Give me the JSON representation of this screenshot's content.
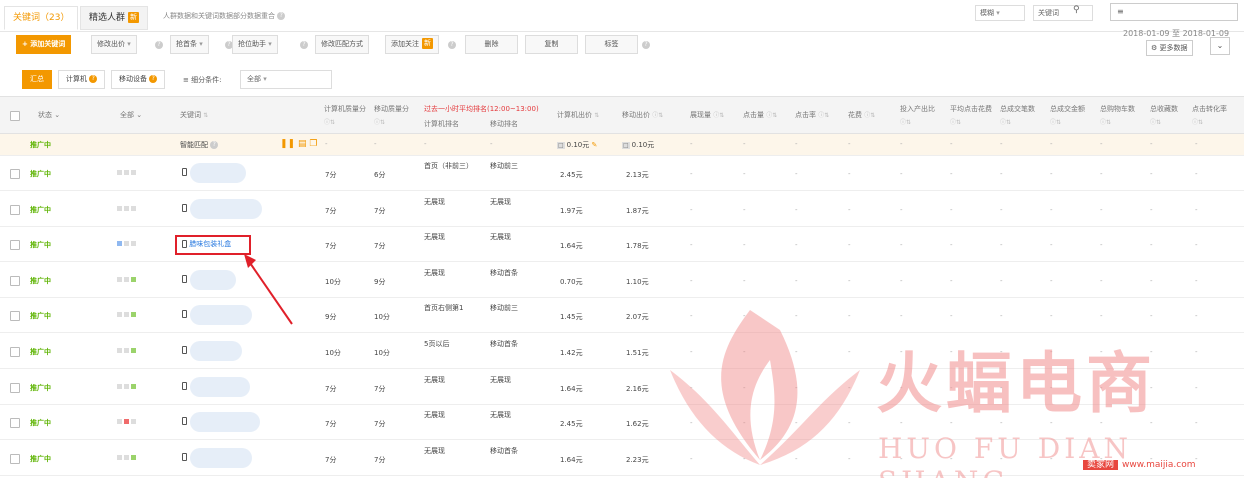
{
  "tabs": {
    "keywords": "关键词（23）",
    "crowd": "精选人群",
    "crowd_badge": "新",
    "tip": "人群数据和关键词数据部分数据重合"
  },
  "top_right": {
    "select1": "模糊",
    "select2": "关键词",
    "search_icon": "search-icon",
    "box_icon": "≡"
  },
  "toolbar": {
    "add_keyword": "+ 添加关键词",
    "modify_bid": "修改出价",
    "grab_rank": "抢首条",
    "rank_bid": "抢位助手",
    "modify_match": "修改匹配方式",
    "add_focus": "添加关注",
    "add_focus_badge": "新",
    "delete": "删除",
    "copy": "复制",
    "label": "标签",
    "date_range": "2018-01-09 至 2018-01-09",
    "more_data": "更多数据"
  },
  "filter": {
    "summary": "汇总",
    "computer": "计算机",
    "mobile": "移动设备",
    "condition_label": "细分条件:",
    "condition_value": "全部"
  },
  "headers": {
    "status": "状态",
    "all": "全部",
    "keyword": "关键词",
    "pc_quality": "计算机质量分",
    "mobile_quality": "移动质量分",
    "avg_rank": "过去一小时平均排名(12:00~13:00)",
    "pc_rank": "计算机排名",
    "mobile_rank": "移动排名",
    "pc_bid": "计算机出价",
    "mobile_bid": "移动出价",
    "impressions": "展现量",
    "clicks": "点击量",
    "ctr": "点击率",
    "cost": "花费",
    "roi": "投入产出比",
    "avg_cpc": "平均点击花费",
    "deal_count": "总成交笔数",
    "deal_amount": "总成交金额",
    "cart": "总购物车数",
    "fav": "总收藏数",
    "cvr": "点击转化率"
  },
  "smart_match": {
    "status": "推广中",
    "keyword": "智能匹配",
    "pc_bid": "0.10元",
    "mobile_bid": "0.10元",
    "dash": "-"
  },
  "rows": [
    {
      "status": "推广中",
      "keyword": "",
      "pc_q": "7分",
      "m_q": "6分",
      "pc_rank": "首页（非前三）",
      "m_rank": "移动前三",
      "pc_bid": "2.45元",
      "m_bid": "2.13元"
    },
    {
      "status": "推广中",
      "keyword": "",
      "pc_q": "7分",
      "m_q": "7分",
      "pc_rank": "无展现",
      "m_rank": "无展现",
      "pc_bid": "1.97元",
      "m_bid": "1.87元"
    },
    {
      "status": "推广中",
      "keyword": "腊味包装礼盒",
      "pc_q": "7分",
      "m_q": "7分",
      "pc_rank": "无展现",
      "m_rank": "无展现",
      "pc_bid": "1.64元",
      "m_bid": "1.78元"
    },
    {
      "status": "推广中",
      "keyword": "",
      "pc_q": "10分",
      "m_q": "9分",
      "pc_rank": "无展现",
      "m_rank": "移动首条",
      "pc_bid": "0.70元",
      "m_bid": "1.10元"
    },
    {
      "status": "推广中",
      "keyword": "",
      "pc_q": "9分",
      "m_q": "10分",
      "pc_rank": "首页右侧第1",
      "m_rank": "移动前三",
      "pc_bid": "1.45元",
      "m_bid": "2.07元"
    },
    {
      "status": "推广中",
      "keyword": "",
      "pc_q": "10分",
      "m_q": "10分",
      "pc_rank": "5页以后",
      "m_rank": "移动首条",
      "pc_bid": "1.42元",
      "m_bid": "1.51元"
    },
    {
      "status": "推广中",
      "keyword": "",
      "pc_q": "7分",
      "m_q": "7分",
      "pc_rank": "无展现",
      "m_rank": "无展现",
      "pc_bid": "1.64元",
      "m_bid": "2.16元"
    },
    {
      "status": "推广中",
      "keyword": "",
      "pc_q": "7分",
      "m_q": "7分",
      "pc_rank": "无展现",
      "m_rank": "无展现",
      "pc_bid": "2.45元",
      "m_bid": "1.62元"
    },
    {
      "status": "推广中",
      "keyword": "",
      "pc_q": "7分",
      "m_q": "7分",
      "pc_rank": "无展现",
      "m_rank": "移动首条",
      "pc_bid": "1.64元",
      "m_bid": "2.23元"
    }
  ],
  "watermark": {
    "title": "火蝠电商",
    "subtitle": "HUO FU DIAN SHANG",
    "site_name": "卖家网",
    "site_url": "www.maijia.com"
  },
  "colors": {
    "accent": "#f39800",
    "status_green": "#5cb300",
    "highlight_red": "#e0202a",
    "link_blue": "#2b7be0"
  }
}
